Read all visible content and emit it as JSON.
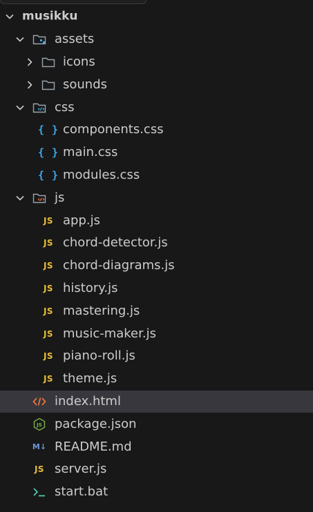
{
  "explorer": {
    "root": {
      "label": "musikku",
      "expanded": true
    },
    "items": [
      {
        "label": "assets",
        "type": "folder",
        "expanded": true,
        "icon": "folder-assets-icon"
      },
      {
        "label": "icons",
        "type": "folder",
        "expanded": false,
        "icon": "folder-icon"
      },
      {
        "label": "sounds",
        "type": "folder",
        "expanded": false,
        "icon": "folder-icon"
      },
      {
        "label": "css",
        "type": "folder",
        "expanded": true,
        "icon": "folder-css-icon"
      },
      {
        "label": "components.css",
        "type": "file",
        "icon": "css-braces-icon",
        "icon_text": "{ }"
      },
      {
        "label": "main.css",
        "type": "file",
        "icon": "css-braces-icon",
        "icon_text": "{ }"
      },
      {
        "label": "modules.css",
        "type": "file",
        "icon": "css-braces-icon",
        "icon_text": "{ }"
      },
      {
        "label": "js",
        "type": "folder",
        "expanded": true,
        "icon": "folder-js-icon"
      },
      {
        "label": "app.js",
        "type": "file",
        "icon": "javascript-icon",
        "icon_text": "JS"
      },
      {
        "label": "chord-detector.js",
        "type": "file",
        "icon": "javascript-icon",
        "icon_text": "JS"
      },
      {
        "label": "chord-diagrams.js",
        "type": "file",
        "icon": "javascript-icon",
        "icon_text": "JS"
      },
      {
        "label": "history.js",
        "type": "file",
        "icon": "javascript-icon",
        "icon_text": "JS"
      },
      {
        "label": "mastering.js",
        "type": "file",
        "icon": "javascript-icon",
        "icon_text": "JS"
      },
      {
        "label": "music-maker.js",
        "type": "file",
        "icon": "javascript-icon",
        "icon_text": "JS"
      },
      {
        "label": "piano-roll.js",
        "type": "file",
        "icon": "javascript-icon",
        "icon_text": "JS"
      },
      {
        "label": "theme.js",
        "type": "file",
        "icon": "javascript-icon",
        "icon_text": "JS"
      },
      {
        "label": "index.html",
        "type": "file",
        "icon": "html-code-icon",
        "selected": true
      },
      {
        "label": "package.json",
        "type": "file",
        "icon": "nodejs-icon"
      },
      {
        "label": "README.md",
        "type": "file",
        "icon": "markdown-icon",
        "icon_text": "M↓"
      },
      {
        "label": "server.js",
        "type": "file",
        "icon": "javascript-icon",
        "icon_text": "JS"
      },
      {
        "label": "start.bat",
        "type": "file",
        "icon": "terminal-icon"
      }
    ]
  },
  "colors": {
    "background": "#181818",
    "selected_row": "#37373d",
    "text": "#cccccc",
    "js_yellow": "#e8bd36",
    "css_blue": "#3fa8e8",
    "html_orange": "#e9733b",
    "node_green": "#7bb34a",
    "terminal_teal": "#4ec9b0",
    "markdown_blue": "#6d97d4"
  }
}
